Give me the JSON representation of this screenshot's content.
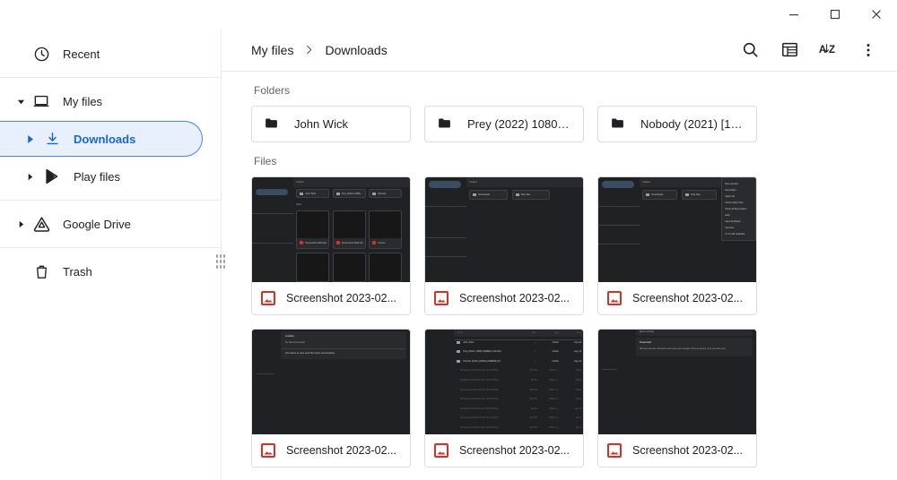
{
  "window": {
    "controls": [
      {
        "name": "minimize",
        "label": "Minimize"
      },
      {
        "name": "maximize",
        "label": "Maximize"
      },
      {
        "name": "close",
        "label": "Close"
      }
    ]
  },
  "sidebar": {
    "items": [
      {
        "label": "Recent",
        "icon": "clock-icon",
        "level": 0,
        "twisty": "none",
        "selected": false
      },
      {
        "label": "My files",
        "icon": "laptop-icon",
        "level": 0,
        "twisty": "expanded",
        "selected": false
      },
      {
        "label": "Downloads",
        "icon": "download-icon",
        "level": 1,
        "twisty": "collapsed",
        "selected": true
      },
      {
        "label": "Play files",
        "icon": "play-store-icon",
        "level": 1,
        "twisty": "collapsed",
        "selected": false
      },
      {
        "label": "Google Drive",
        "icon": "google-drive-icon",
        "level": 0,
        "twisty": "collapsed",
        "selected": false
      },
      {
        "label": "Trash",
        "icon": "trash-icon",
        "level": 0,
        "twisty": "none",
        "selected": false
      }
    ],
    "splitter": "drag-handle"
  },
  "toolbar": {
    "breadcrumb": [
      {
        "label": "My files"
      },
      {
        "label": "Downloads"
      }
    ],
    "separator": "chevron-right-icon",
    "actions": [
      {
        "name": "search-button",
        "icon": "search-icon",
        "label": "Search"
      },
      {
        "name": "view-toggle-button",
        "icon": "list-view-icon",
        "label": "Switch to list view"
      },
      {
        "name": "sort-button",
        "icon": "sort-az-icon",
        "label": "A-Z"
      },
      {
        "name": "more-menu-button",
        "icon": "more-vertical-icon",
        "label": "More..."
      }
    ]
  },
  "content": {
    "folders_label": "Folders",
    "files_label": "Files",
    "folders": [
      {
        "name": "John Wick"
      },
      {
        "name": "Prey (2022) 1080p ..."
      },
      {
        "name": "Nobody (2021) [108..."
      }
    ],
    "files": [
      {
        "name": "Screenshot 2023-02...",
        "type": "image",
        "badge": "image-icon"
      },
      {
        "name": "Screenshot 2023-02...",
        "type": "image",
        "badge": "image-icon"
      },
      {
        "name": "Screenshot 2023-02...",
        "type": "image",
        "badge": "image-icon"
      },
      {
        "name": "Screenshot 2023-02...",
        "type": "image",
        "badge": "image-icon"
      },
      {
        "name": "Screenshot 2023-02...",
        "type": "image",
        "badge": "image-icon"
      },
      {
        "name": "Screenshot 2023-02...",
        "type": "image",
        "badge": "image-icon"
      }
    ]
  },
  "thumbnails": {
    "t1": {
      "folders_label": "Folders",
      "files_label": "Files",
      "chips": [
        "John Wick",
        "Prey (2022) 1080p ..",
        "Nobody"
      ],
      "cards": [
        "Screenshot 2023-02..",
        "Screenshot 2023-02...",
        "Screen"
      ]
    },
    "t2": {
      "folders_label": "Folders",
      "chips": [
        "Downloads",
        "Play files"
      ]
    },
    "t3": {
      "folders_label": "Folders",
      "chips": [
        "Downloads",
        "Play files"
      ],
      "menu": [
        "New window",
        "New folder",
        "Select all",
        "Show hidden files",
        "Show all Play folders",
        "Help",
        "Send feedback",
        "Services",
        "37.41 GB available"
      ]
    },
    "t4": {
      "heading": "Location",
      "path": "My files Downloads",
      "option": "Ask where to save each file before downloading"
    },
    "t5": {
      "columns": [
        "Name",
        "Size",
        "Type",
        "Date"
      ],
      "rows": [
        {
          "name": "John Wick",
          "size": "--",
          "type": "Folder",
          "date": "Aug 16"
        },
        {
          "name": "Prey (2022) 1080p WEBRip x264-RA",
          "size": "--",
          "type": "Folder",
          "date": "Aug 14"
        },
        {
          "name": "Nobody (2021) [1080p] [WEBRip] [5.",
          "size": "--",
          "type": "Folder",
          "date": "Aug 12"
        },
        {
          "name": "Screenshot 2023-02-19 1.01.08 PM.p",
          "size": "107 KB",
          "type": "PNG im...",
          "date": "Today"
        },
        {
          "name": "Screenshot 2023-02-19 1.00.41 PM.p",
          "size": "94 KB",
          "type": "PNG im...",
          "date": "Today"
        },
        {
          "name": "Screenshot 2023-02-19 1.00.33 PM.p",
          "size": "166 KB",
          "type": "PNG im...",
          "date": "Today"
        },
        {
          "name": "Screenshot 2023-02-03 1.19.02 PM.p",
          "size": "143 KB",
          "type": "PNG im...",
          "date": "Today"
        },
        {
          "name": "Screenshot 2023-01-12 3.22.46 AM.p",
          "size": "81 KB",
          "type": "PNG im...",
          "date": "Jan 12"
        },
        {
          "name": "Screenshot 2023-01-04 2.51.22 AM.p",
          "size": "320 KB",
          "type": "PNG im...",
          "date": "Jan 4"
        },
        {
          "name": "Screenshot 2023-01-04 1.38.10 AM.p",
          "size": "204 KB",
          "type": "PNG im...",
          "date": "Jan 4"
        }
      ]
    },
    "t6": {
      "tab": "Reset settings",
      "heading": "Powerwash",
      "body": "Remove all user accounts and reset your Google Chrome device to be just like new"
    }
  }
}
